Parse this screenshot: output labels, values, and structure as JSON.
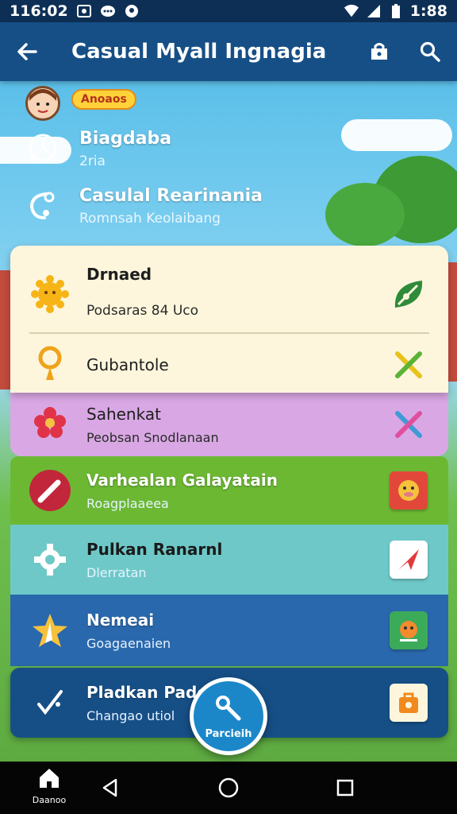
{
  "status_bar": {
    "time": "116:02",
    "right_time": "1:88",
    "icons": [
      "photo-icon",
      "messenger-icon",
      "location-icon",
      "wifi-icon",
      "signal-icon",
      "battery-icon"
    ]
  },
  "app_bar": {
    "title": "Casual Myall Ingnagia",
    "back_icon": "arrow-left-icon",
    "actions": [
      "bag-icon",
      "search-icon"
    ]
  },
  "header": {
    "badge": "Anoaos",
    "rows": [
      {
        "title": "Biagdaba",
        "subtitle": "2ria",
        "icon": "clock-icon"
      },
      {
        "title": "Casulal Rearinania",
        "subtitle": "Romnsah Keolaibang",
        "icon": "phone-icon"
      }
    ]
  },
  "card": {
    "items": [
      {
        "title": "Drnaed",
        "subtitle": "Podsaras 84 Uco",
        "icon": "sun-icon",
        "right_icon": "leaf-icon"
      },
      {
        "title": "Gubantole",
        "subtitle": "",
        "icon": "balloon-icon",
        "right_icon": "check-x-icon"
      }
    ]
  },
  "bands": [
    {
      "title": "Sahenkat",
      "subtitle": "Peobsan Snodlanaan",
      "color": "#d9a8e4",
      "icon": "flower-icon",
      "right_icon": "cross-icon"
    },
    {
      "title": "Varhealan Galayatain",
      "subtitle": "Roagplaaeea",
      "color": "#6cb833",
      "icon": "pencil-icon",
      "right_icon": "pig-tile-icon"
    },
    {
      "title": "Pulkan Ranarnl",
      "subtitle": "Dlerratan",
      "color": "#6fc8c8",
      "icon": "gear-icon",
      "right_icon": "plane-tile-icon"
    },
    {
      "title": "Nemeai",
      "subtitle": "Goagaenaien",
      "color": "#2a68ad",
      "icon": "star-icon",
      "right_icon": "face-tile-icon"
    },
    {
      "title": "Pladkan Padeln",
      "subtitle": "Changao utiol",
      "color": "#164f86",
      "icon": "leaf-check-icon",
      "right_icon": "bag-tile-icon"
    }
  ],
  "fab": {
    "label": "Parcieih",
    "icon": "magnifier-icon"
  },
  "nav": {
    "home_label": "Daanoo"
  },
  "colors": {
    "status": "#0d2f55",
    "appbar": "#164f86",
    "card": "#fdf6dc",
    "fab": "#1b87c9"
  }
}
